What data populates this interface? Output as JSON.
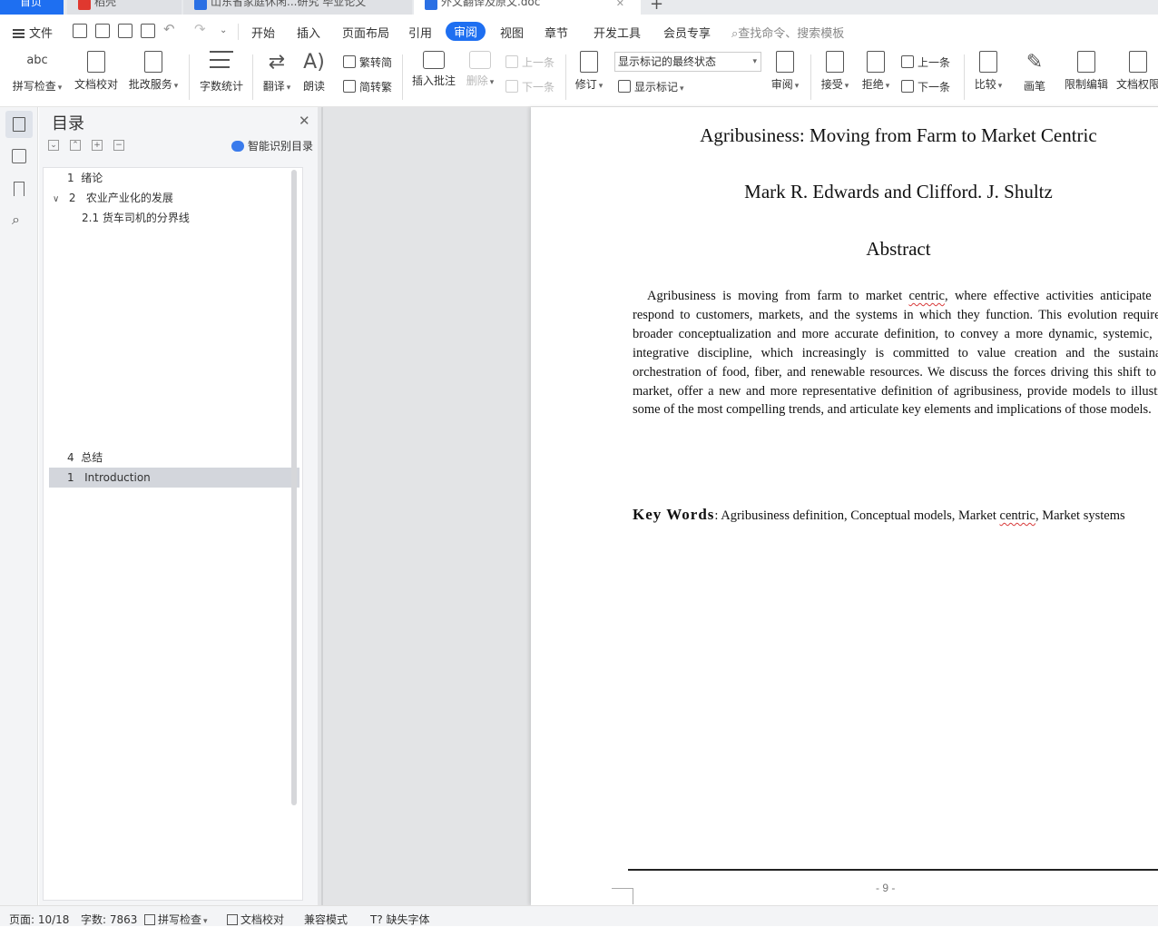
{
  "tabs": {
    "home": "首页",
    "t1": "稻壳",
    "t2": "山东省家庭休闲...研究 毕业论文",
    "t3": "外文翻译及原文.doc"
  },
  "menu": {
    "file": "文件",
    "items": [
      "开始",
      "插入",
      "页面布局",
      "引用",
      "审阅",
      "视图",
      "章节",
      "开发工具",
      "会员专享"
    ],
    "active": "审阅",
    "search_placeholder": "查找命令、搜索模板"
  },
  "ribbon": {
    "spell": "拼写检查",
    "proof": "文档校对",
    "revise_service": "批改服务",
    "word_count": "字数统计",
    "translate": "翻译",
    "read_aloud": "朗读",
    "trad_to_simp": "繁转简",
    "simp_to_trad": "简转繁",
    "insert_comment": "插入批注",
    "delete": "删除",
    "prev_comment": "上一条",
    "next_comment": "下一条",
    "track_changes": "修订",
    "markup_state": "显示标记的最终状态",
    "show_markup": "显示标记",
    "review": "审阅",
    "accept": "接受",
    "reject": "拒绝",
    "prev_change": "上一条",
    "next_change": "下一条",
    "compare": "比较",
    "pen": "画笔",
    "restrict_edit": "限制编辑",
    "doc_permission": "文档权限",
    "abc": "abc"
  },
  "toc": {
    "title": "目录",
    "smart": "智能识别目录",
    "items": [
      {
        "num": "1",
        "label": "绪论"
      },
      {
        "num": "2",
        "label": "农业产业化的发展"
      },
      {
        "num": "2.1",
        "label": "货车司机的分界线"
      },
      {
        "num": "4",
        "label": "总结"
      },
      {
        "num": "1",
        "label": "Introduction"
      }
    ]
  },
  "document": {
    "title": "Agribusiness: Moving from Farm to Market Centric",
    "authors": "Mark R. Edwards and Clifford. J. Shultz",
    "abstract_heading": "Abstract",
    "abstract_p1": "Agribusiness is moving from farm to market ",
    "abstract_sq": "centric",
    "abstract_p2": ", where effective activities anticipate and respond to customers, markets, and the systems in which they function. This evolution requires a broader conceptualization and more accurate definition, to convey a more dynamic, systemic, and integrative discipline, which increasingly is committed to value creation and the sustainable orchestration of food, fiber, and renewable resources. We discuss the forces driving this shift to the market, offer a new and more representative definition of agribusiness, provide models to illustrate some of the most compelling trends, and articulate key elements and implications of those models.",
    "kw_label": "Key Words",
    "kw_p1": ": Agribusiness definition, Conceptual models, Market ",
    "kw_sq": "centric",
    "kw_p2": ", Market systems",
    "page_number": "- 9 -"
  },
  "status": {
    "page": "页面: 10/18",
    "words": "字数: 7863",
    "spell": "拼写检查",
    "proof": "文档校对",
    "compat": "兼容模式",
    "missing_font": "缺失字体"
  },
  "colors": {
    "accent": "#1e6ff1",
    "squiggle": "#d83a3a"
  }
}
